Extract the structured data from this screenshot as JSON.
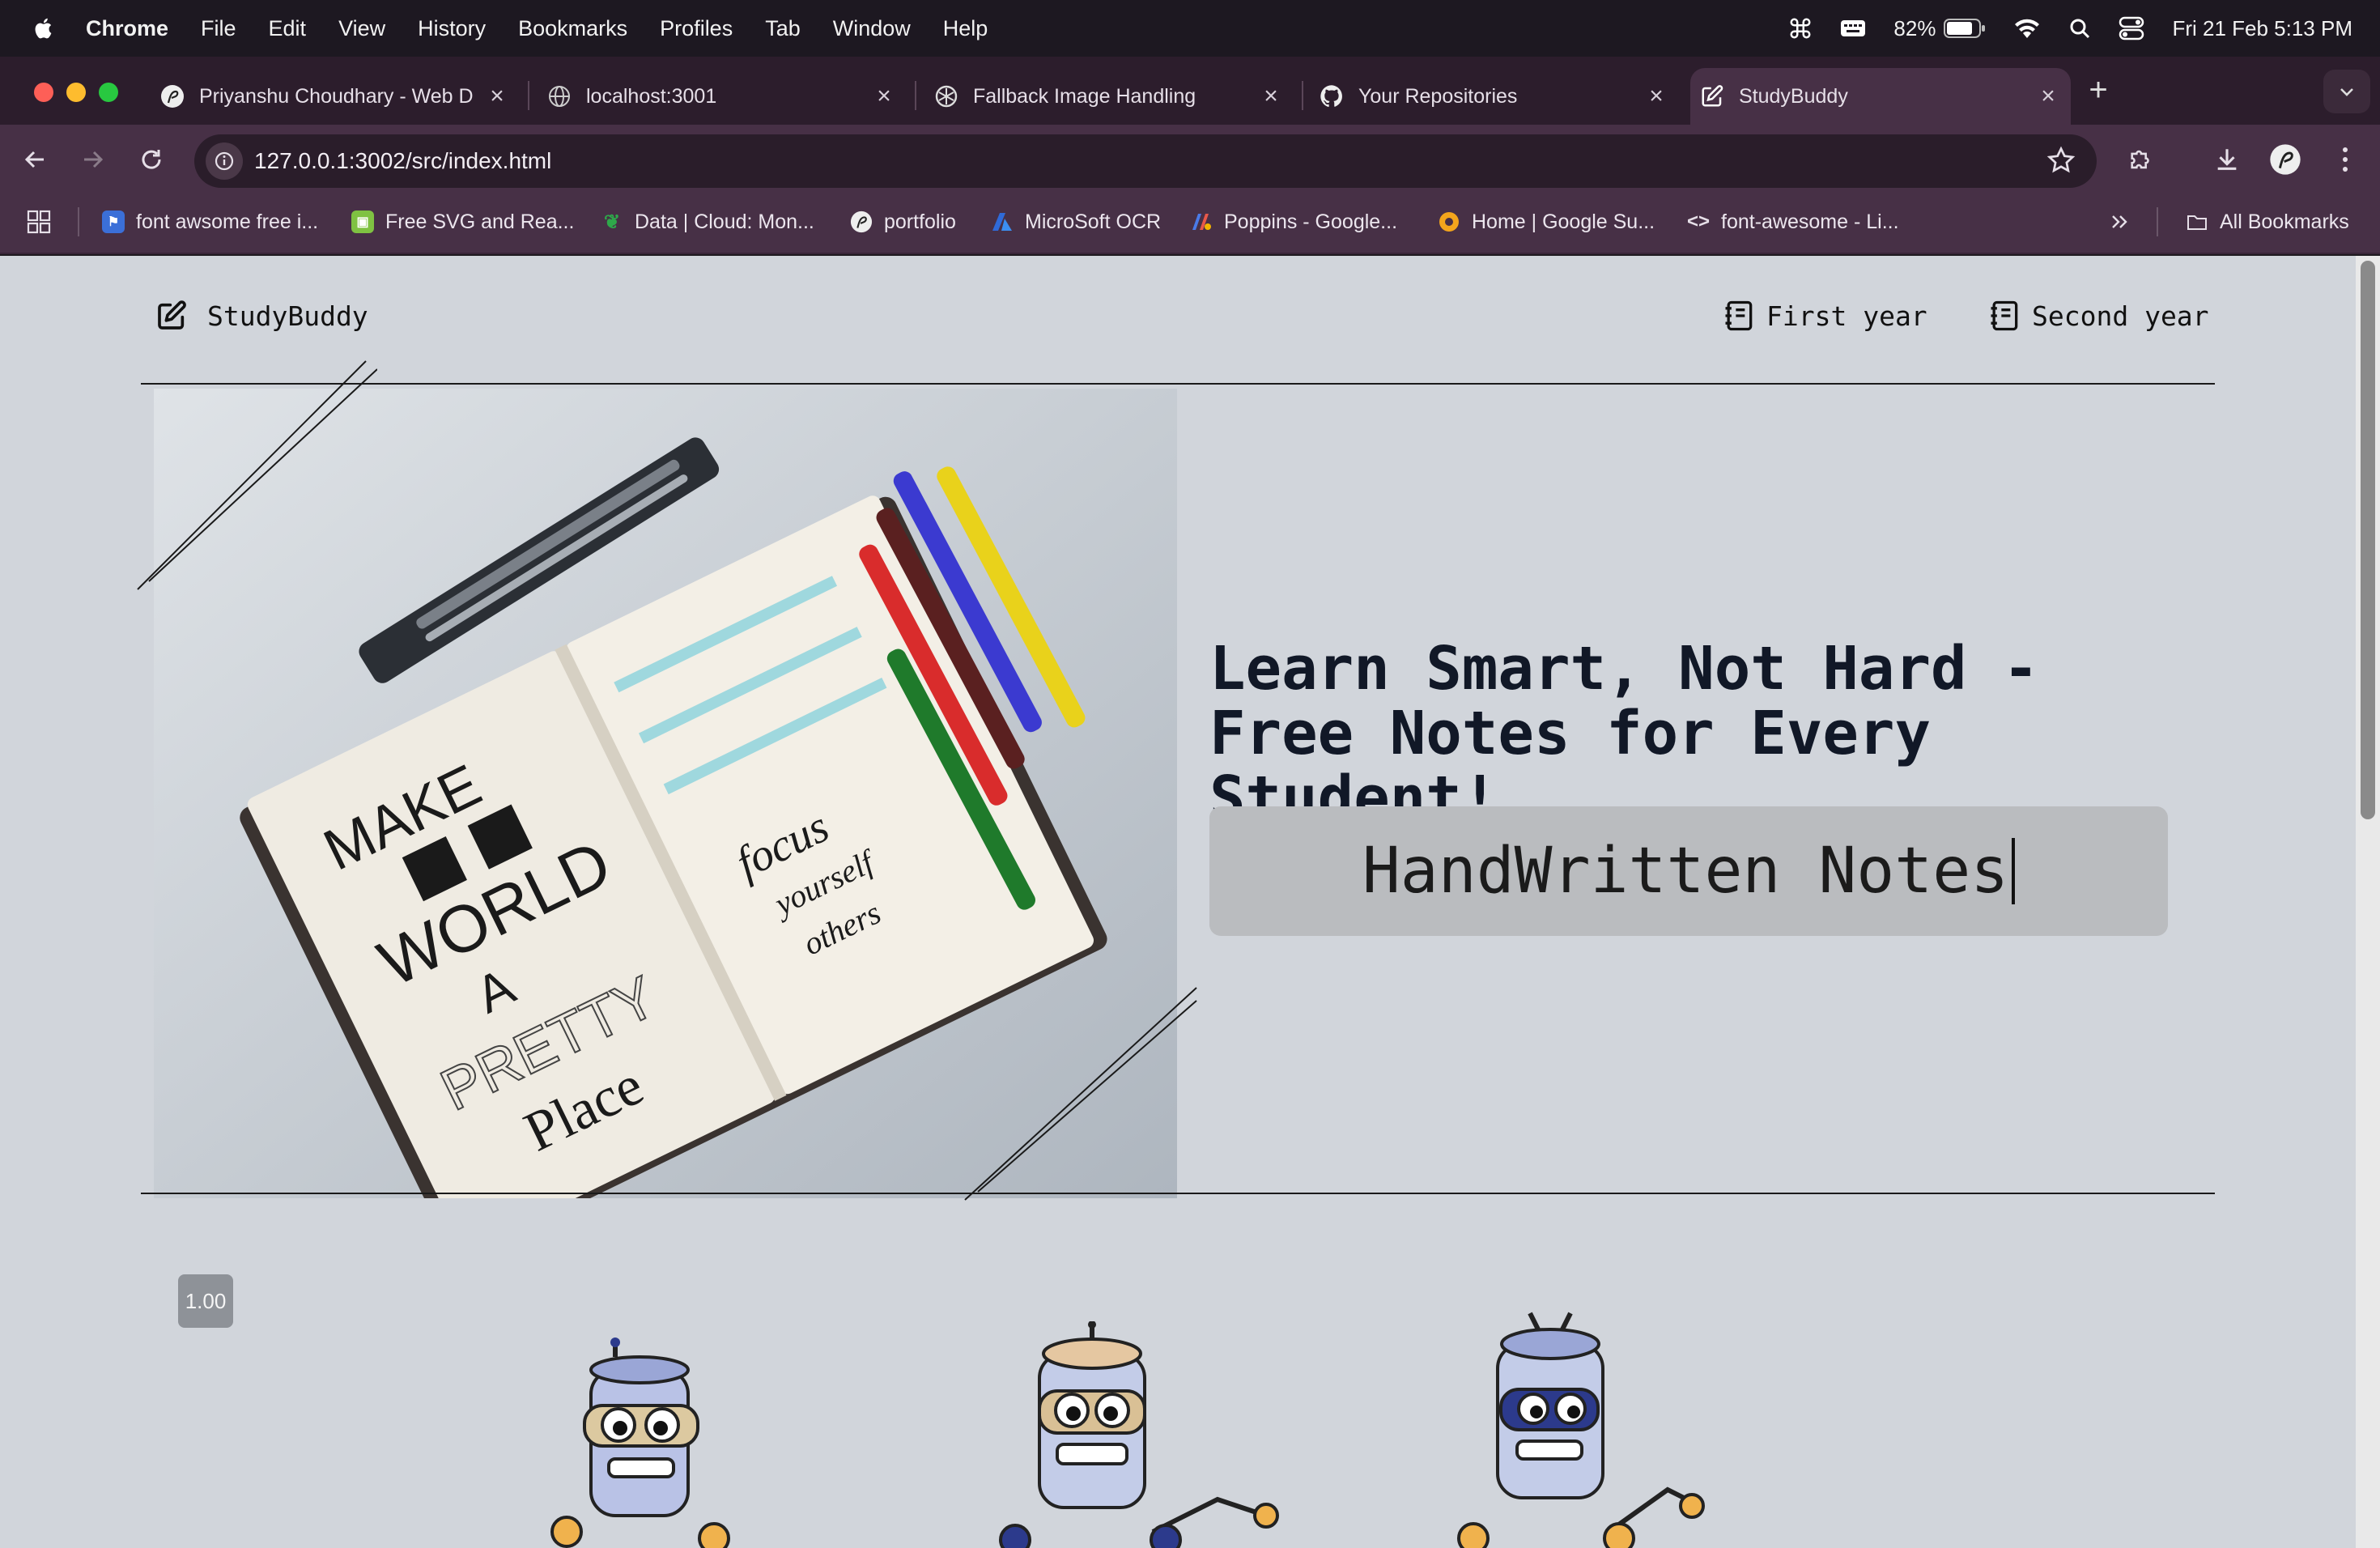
{
  "menubar": {
    "app_name": "Chrome",
    "menus": [
      "File",
      "Edit",
      "View",
      "History",
      "Bookmarks",
      "Profiles",
      "Tab",
      "Window",
      "Help"
    ],
    "battery": "82%",
    "datetime": "Fri 21 Feb  5:13 PM"
  },
  "tabs": [
    {
      "title": "Priyanshu Choudhary - Web D",
      "icon": "avatar-icon"
    },
    {
      "title": "localhost:3001",
      "icon": "globe-icon"
    },
    {
      "title": "Fallback Image Handling",
      "icon": "chatgpt-icon"
    },
    {
      "title": "Your Repositories",
      "icon": "github-icon"
    },
    {
      "title": "StudyBuddy",
      "icon": "edit-icon",
      "active": true
    }
  ],
  "omnibox": {
    "url": "127.0.0.1:3002/src/index.html"
  },
  "bookmarks": {
    "items": [
      {
        "label": "font awsome free i...",
        "color": "#3b6fd8"
      },
      {
        "label": "Free SVG and Rea...",
        "color": "#7fc242"
      },
      {
        "label": "Data | Cloud: Mon...",
        "color": "#2e7d32"
      },
      {
        "label": "portfolio",
        "color": "#eeeeee"
      },
      {
        "label": "MicroSoft OCR",
        "color": "#2f6ad8"
      },
      {
        "label": "Poppins - Google...",
        "color": "#6e7bd8"
      },
      {
        "label": "Home | Google Su...",
        "color": "#f4a51c"
      },
      {
        "label": "font-awesome - Li...",
        "color": "#cfcfcf"
      }
    ],
    "all_bookmarks": "All Bookmarks"
  },
  "site": {
    "brand": "StudyBuddy",
    "nav": [
      "First year",
      "Second year"
    ],
    "headline": "Learn Smart, Not Hard - Free Notes for Every Student!",
    "typed_text": "HandWritten Notes",
    "badge": "1.00"
  },
  "colors": {
    "page_bg": "#d1d5db",
    "typer_bg": "#babcbf",
    "chrome_frame": "#473046"
  }
}
